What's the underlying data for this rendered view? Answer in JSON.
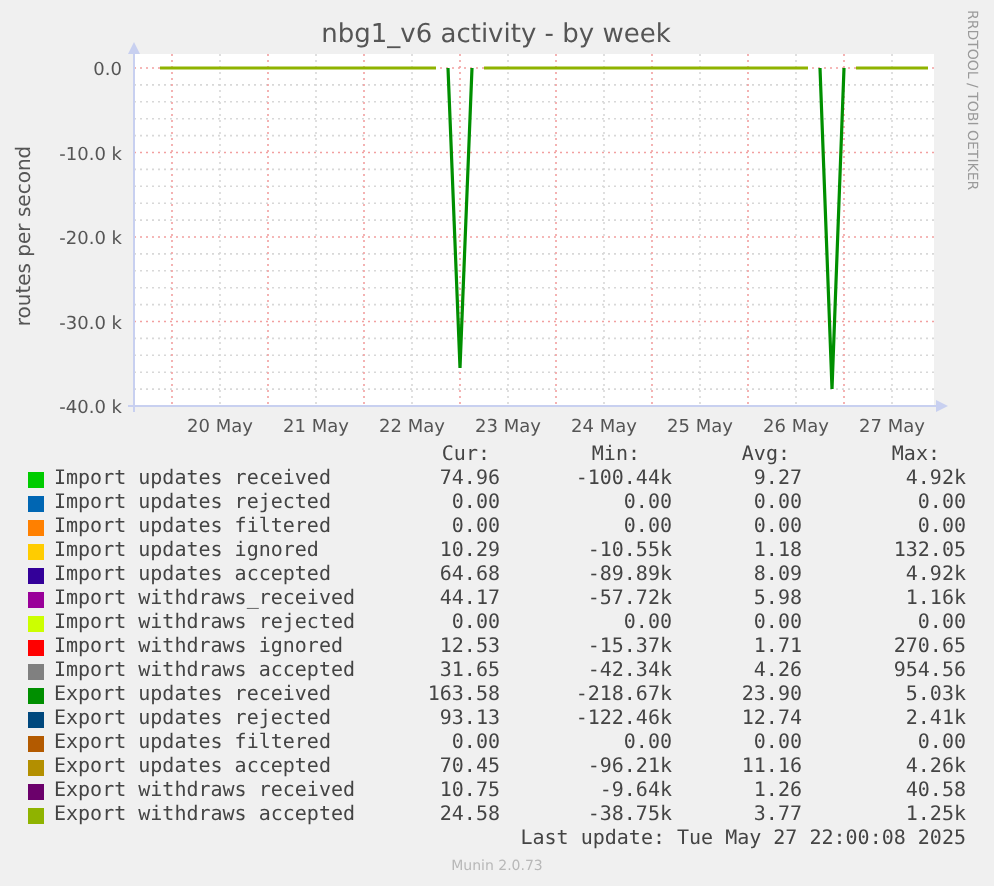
{
  "side_label": "RRDTOOL / TOBI OETIKER",
  "chart_data": {
    "type": "line",
    "title": "nbg1_v6 activity - by week",
    "ylabel": "routes per second",
    "ylim": [
      -40000,
      0
    ],
    "yticks": [
      {
        "value": 0,
        "label": "0.0"
      },
      {
        "value": -10000,
        "label": "-10.0 k"
      },
      {
        "value": -20000,
        "label": "-20.0 k"
      },
      {
        "value": -30000,
        "label": "-30.0 k"
      },
      {
        "value": -40000,
        "label": "-40.0 k"
      }
    ],
    "categories": [
      null,
      null,
      null,
      null,
      null,
      null,
      null,
      "20 May",
      null,
      null,
      null,
      null,
      null,
      null,
      null,
      "21 May",
      null,
      null,
      null,
      null,
      null,
      null,
      null,
      "22 May",
      null,
      null,
      null,
      null,
      null,
      null,
      null,
      "23 May",
      null,
      null,
      null,
      null,
      null,
      null,
      null,
      "24 May",
      null,
      null,
      null,
      null,
      null,
      null,
      null,
      "25 May",
      null,
      null,
      null,
      null,
      null,
      null,
      null,
      "26 May",
      null,
      null,
      null,
      null,
      null,
      null,
      null,
      "27 May",
      null,
      null,
      null
    ],
    "grid": true,
    "series": [
      {
        "color": "#8fb300",
        "values": [
          null,
          null,
          0,
          0,
          0,
          0,
          0,
          0,
          0,
          0,
          0,
          0,
          0,
          0,
          0,
          0,
          0,
          0,
          0,
          0,
          0,
          0,
          0,
          0,
          0,
          0,
          null,
          null,
          null,
          0,
          0,
          0,
          0,
          0,
          0,
          0,
          0,
          0,
          0,
          0,
          0,
          0,
          0,
          0,
          0,
          0,
          0,
          0,
          0,
          0,
          0,
          0,
          0,
          0,
          0,
          0,
          0,
          null,
          null,
          null,
          0,
          0,
          0,
          0,
          0,
          0,
          0
        ]
      },
      {
        "color": "#008f00",
        "values": [
          null,
          null,
          null,
          null,
          null,
          null,
          null,
          null,
          null,
          null,
          null,
          null,
          null,
          null,
          null,
          null,
          null,
          null,
          null,
          null,
          null,
          null,
          null,
          null,
          null,
          null,
          0,
          -35500,
          0,
          null,
          null,
          null,
          null,
          null,
          null,
          null,
          null,
          null,
          null,
          null,
          null,
          null,
          null,
          null,
          null,
          null,
          null,
          null,
          null,
          null,
          null,
          null,
          null,
          null,
          null,
          null,
          null,
          0,
          -38000,
          0,
          null,
          null,
          null,
          null,
          null,
          null,
          null
        ]
      }
    ]
  },
  "legend": {
    "headers": [
      "Cur:",
      "Min:",
      "Avg:",
      "Max:"
    ],
    "rows": [
      {
        "name": "Import updates received",
        "color": "#00cc00",
        "cur": "74.96",
        "min": "-100.44k",
        "avg": "9.27",
        "max": "4.92k"
      },
      {
        "name": "Import updates rejected",
        "color": "#0066b3",
        "cur": "0.00",
        "min": "0.00",
        "avg": "0.00",
        "max": "0.00"
      },
      {
        "name": "Import updates filtered",
        "color": "#ff8000",
        "cur": "0.00",
        "min": "0.00",
        "avg": "0.00",
        "max": "0.00"
      },
      {
        "name": "Import updates ignored",
        "color": "#ffcc00",
        "cur": "10.29",
        "min": "-10.55k",
        "avg": "1.18",
        "max": "132.05"
      },
      {
        "name": "Import updates accepted",
        "color": "#330099",
        "cur": "64.68",
        "min": "-89.89k",
        "avg": "8.09",
        "max": "4.92k"
      },
      {
        "name": "Import withdraws_received",
        "color": "#990099",
        "cur": "44.17",
        "min": "-57.72k",
        "avg": "5.98",
        "max": "1.16k"
      },
      {
        "name": "Import withdraws rejected",
        "color": "#ccff00",
        "cur": "0.00",
        "min": "0.00",
        "avg": "0.00",
        "max": "0.00"
      },
      {
        "name": "Import withdraws ignored",
        "color": "#ff0000",
        "cur": "12.53",
        "min": "-15.37k",
        "avg": "1.71",
        "max": "270.65"
      },
      {
        "name": "Import withdraws accepted",
        "color": "#808080",
        "cur": "31.65",
        "min": "-42.34k",
        "avg": "4.26",
        "max": "954.56"
      },
      {
        "name": "Export updates received",
        "color": "#008f00",
        "cur": "163.58",
        "min": "-218.67k",
        "avg": "23.90",
        "max": "5.03k"
      },
      {
        "name": "Export updates rejected",
        "color": "#00487d",
        "cur": "93.13",
        "min": "-122.46k",
        "avg": "12.74",
        "max": "2.41k"
      },
      {
        "name": "Export updates filtered",
        "color": "#b35a00",
        "cur": "0.00",
        "min": "0.00",
        "avg": "0.00",
        "max": "0.00"
      },
      {
        "name": "Export updates accepted",
        "color": "#b38f00",
        "cur": "70.45",
        "min": "-96.21k",
        "avg": "11.16",
        "max": "4.26k"
      },
      {
        "name": "Export withdraws received",
        "color": "#6b006b",
        "cur": "10.75",
        "min": "-9.64k",
        "avg": "1.26",
        "max": "40.58"
      },
      {
        "name": "Export withdraws accepted",
        "color": "#8fb300",
        "cur": "24.58",
        "min": "-38.75k",
        "avg": "3.77",
        "max": "1.25k"
      }
    ]
  },
  "last_update": "Last update: Tue May 27 22:00:08 2025",
  "footer": "Munin 2.0.73"
}
